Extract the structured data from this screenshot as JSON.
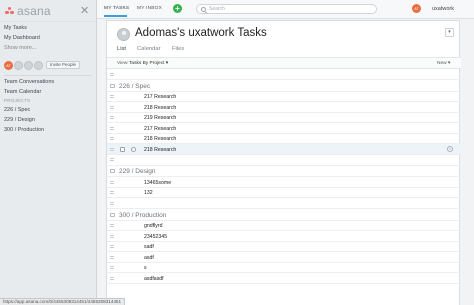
{
  "sidebar": {
    "logo_text": "asana",
    "nav": [
      "My Tasks",
      "My Dashboard",
      "Show more..."
    ],
    "team": {
      "avatar": "AT",
      "invite_label": "Invite People"
    },
    "links": [
      "Team Conversations",
      "Team Calendar"
    ],
    "projects_header": "PROJECTS",
    "projects": [
      "226 / Spec",
      "229 / Design",
      "300 / Production"
    ]
  },
  "topbar": {
    "tabs": [
      "MY TASKS",
      "MY INBOX"
    ],
    "add_symbol": "+",
    "search_placeholder": "Search",
    "user_avatar": "AT",
    "user_name": "uxatwork"
  },
  "panel": {
    "title": "Adomas's uxatwork Tasks",
    "dropdown_symbol": "▾",
    "tabs": [
      "List",
      "Calendar",
      "Files"
    ],
    "view_label": "View:",
    "view_value": "Tasks By Project ▾",
    "new_label": "New ▾"
  },
  "sections": [
    {
      "name": "226 / Spec",
      "tasks": [
        "217 Research",
        "218 Research",
        "219 Research",
        "217 Research",
        "218 Research",
        "218 Research"
      ],
      "highlighted_index": 5
    },
    {
      "name": "229 / Design",
      "tasks": [
        "13465some",
        "132"
      ]
    },
    {
      "name": "300 / Production",
      "tasks": [
        "gndflyrd",
        "23452345",
        "sadf",
        "asdf",
        "s",
        "asdfasdf"
      ]
    }
  ],
  "row_arrow": "›",
  "statusbar": {
    "url": "https://app.asana.com/0/4455308314451/4455308314451"
  },
  "colors": {
    "accent_blue": "#3c9fdc",
    "add_green": "#35b24b",
    "avatar_orange": "#ea6d3f",
    "logo_coral": "#f06a6a"
  }
}
